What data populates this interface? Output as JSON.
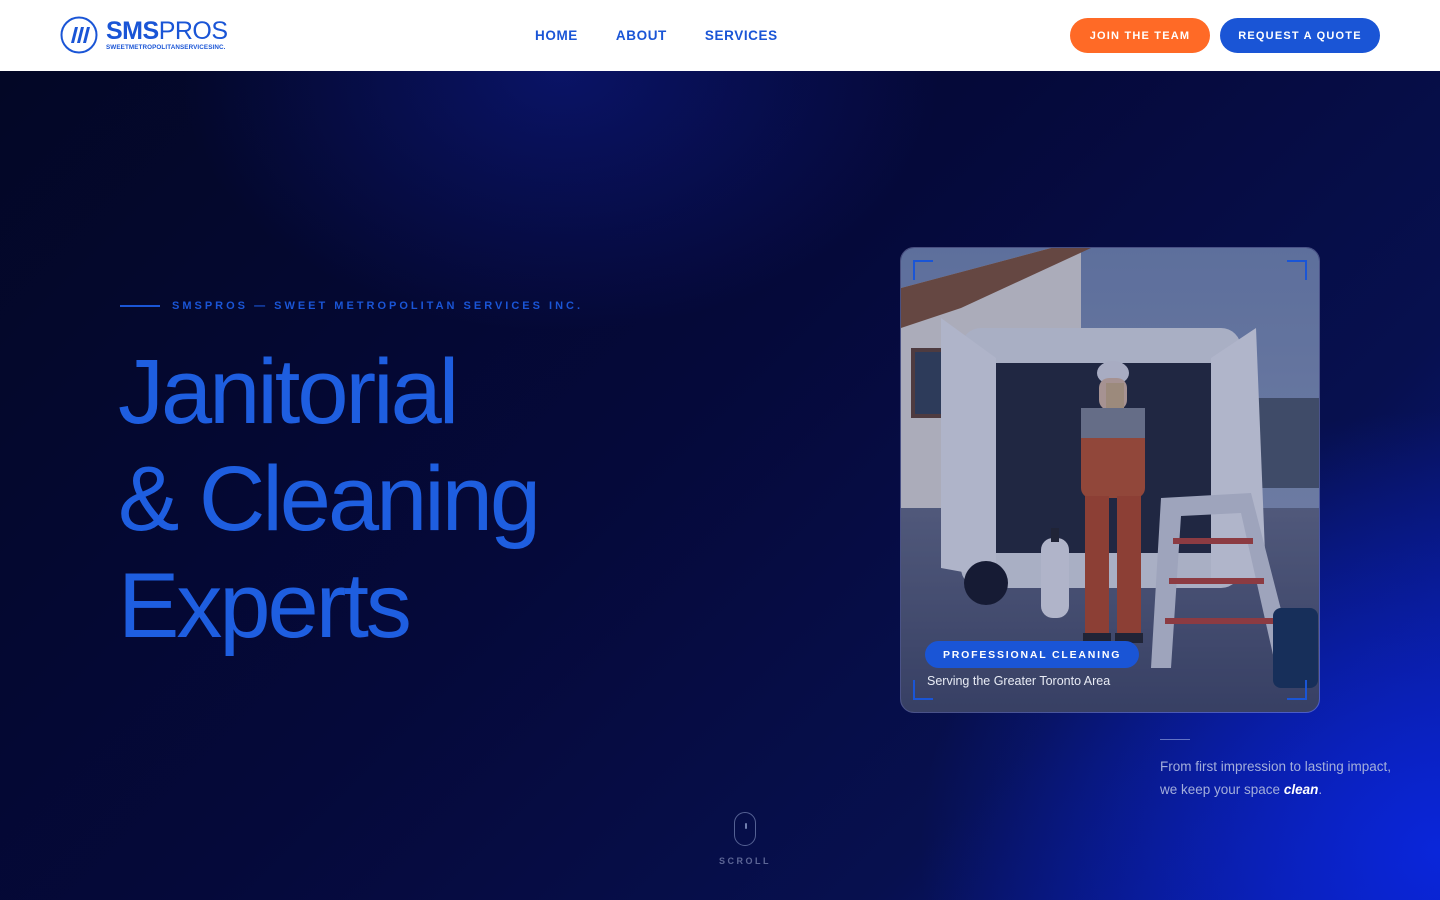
{
  "header": {
    "logo": {
      "name_bold": "SMS",
      "name_light": "PROS",
      "subtitle": "SWEETMETROPOLITANSERVICESINC.",
      "icon": "logo-stripes-icon"
    },
    "nav": [
      {
        "label": "HOME"
      },
      {
        "label": "ABOUT"
      },
      {
        "label": "SERVICES"
      }
    ],
    "join_label": "JOIN THE TEAM",
    "quote_label": "REQUEST A QUOTE"
  },
  "hero": {
    "eyebrow": "SMSPROS — SWEET METROPOLITAN SERVICES INC.",
    "headline": [
      "Janitorial",
      "& Cleaning",
      "Experts"
    ],
    "card": {
      "badge": "PROFESSIONAL CLEANING",
      "caption": "Serving the Greater Toronto Area"
    },
    "tagline_prefix": "From first impression to lasting impact, we keep your space ",
    "tagline_emphasis": "clean",
    "tagline_suffix": ".",
    "scroll_label": "SCROLL"
  },
  "colors": {
    "brand_blue": "#1a55d6",
    "accent_orange": "#ff6a26",
    "hero_dark": "#04082e"
  }
}
